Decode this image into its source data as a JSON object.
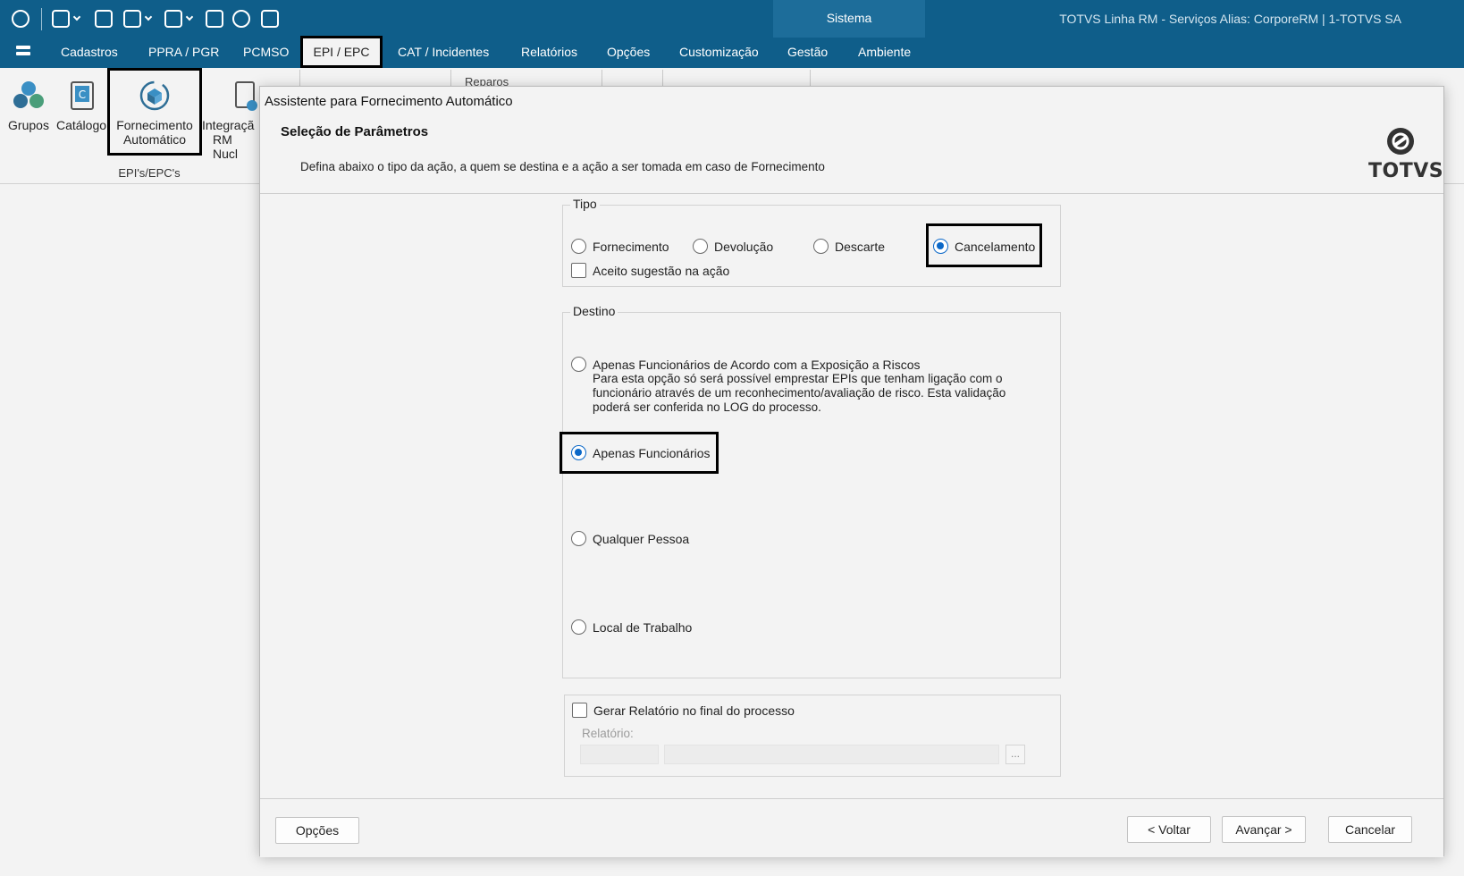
{
  "titlebar": {
    "system_tab": "Sistema",
    "app_title": "TOTVS Linha RM - Serviços  Alias: CorporeRM | 1-TOTVS SA"
  },
  "menu": {
    "items": [
      "Cadastros",
      "PPRA / PGR",
      "PCMSO",
      "EPI / EPC",
      "CAT / Incidentes",
      "Relatórios",
      "Opções",
      "Customização",
      "Gestão",
      "Ambiente"
    ]
  },
  "ribbon": {
    "buttons": [
      {
        "label1": "Grupos",
        "label2": ""
      },
      {
        "label1": "Catálogo",
        "label2": ""
      },
      {
        "label1": "Fornecimento",
        "label2": "Automático"
      },
      {
        "label1": "Integraçã",
        "label2": "RM Nucl"
      }
    ],
    "group_label": "EPI's/EPC's",
    "partial_text": "Reparos"
  },
  "dialog": {
    "title": "Assistente para Fornecimento Automático",
    "heading": "Seleção de Parâmetros",
    "description": "Defina abaixo o tipo da ação, a quem se destina e a ação a ser tomada em caso de Fornecimento",
    "logo_text": "TOTVS",
    "tipo": {
      "legend": "Tipo",
      "options": [
        "Fornecimento",
        "Devolução",
        "Descarte",
        "Cancelamento"
      ],
      "selected": "Cancelamento",
      "checkbox_label": "Aceito sugestão na ação",
      "checkbox_checked": false
    },
    "destino": {
      "legend": "Destino",
      "options": [
        {
          "label": "Apenas Funcionários de Acordo com a Exposição a Riscos",
          "note": "Para esta opção só será possível emprestar EPIs que tenham ligação com o funcionário através de um reconhecimento/avaliação de risco. Esta validação poderá ser conferida no LOG do processo."
        },
        {
          "label": "Apenas Funcionários",
          "note": ""
        },
        {
          "label": "Qualquer Pessoa",
          "note": ""
        },
        {
          "label": "Local de Trabalho",
          "note": ""
        }
      ],
      "selected": "Apenas Funcionários"
    },
    "relatorio": {
      "checkbox_label": "Gerar Relatório no final do processo",
      "checkbox_checked": false,
      "field_label": "Relatório:",
      "ellipsis": "..."
    },
    "footer": {
      "options_button": "Opções",
      "back_button": "< Voltar",
      "next_button": "Avançar >",
      "cancel_button": "Cancelar"
    }
  },
  "colors": {
    "titlebar": "#0f5e8a",
    "accent": "#0b68c8",
    "highlight_border": "#000000"
  }
}
